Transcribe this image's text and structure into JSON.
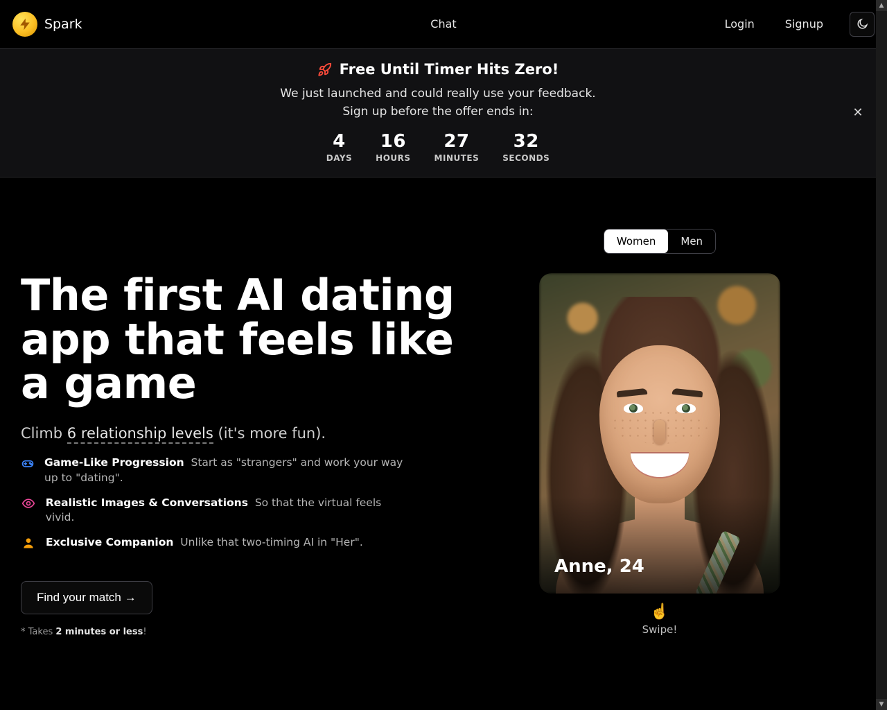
{
  "brand": {
    "name": "Spark"
  },
  "nav": {
    "center": "Chat",
    "login": "Login",
    "signup": "Signup"
  },
  "banner": {
    "heading": "Free Until Timer Hits Zero!",
    "line1": "We just launched and could really use your feedback.",
    "line2": "Sign up before the offer ends in:",
    "countdown": {
      "days": {
        "value": "4",
        "label": "DAYS"
      },
      "hours": {
        "value": "16",
        "label": "HOURS"
      },
      "minutes": {
        "value": "27",
        "label": "MINUTES"
      },
      "seconds": {
        "value": "32",
        "label": "SECONDS"
      }
    }
  },
  "hero": {
    "headline": "The first AI dating app that feels like a game",
    "sub_prefix": "Climb ",
    "sub_link": "6 relationship levels",
    "sub_suffix": " (it's more fun).",
    "features": {
      "f1": {
        "title": "Game-Like Progression",
        "desc": "Start as \"strangers\" and work your way up to \"dating\"."
      },
      "f2": {
        "title": "Realistic Images & Conversations",
        "desc": "So that the virtual feels vivid."
      },
      "f3": {
        "title": "Exclusive Companion",
        "desc": "Unlike that two-timing AI in \"Her\"."
      }
    },
    "cta": "Find your match →",
    "footnote_prefix": "* Takes ",
    "footnote_bold": "2 minutes or less",
    "footnote_suffix": "!"
  },
  "right": {
    "toggle": {
      "women": "Women",
      "men": "Men",
      "active": "women"
    },
    "card": {
      "caption": "Anne, 24"
    },
    "swipe": "Swipe!"
  }
}
